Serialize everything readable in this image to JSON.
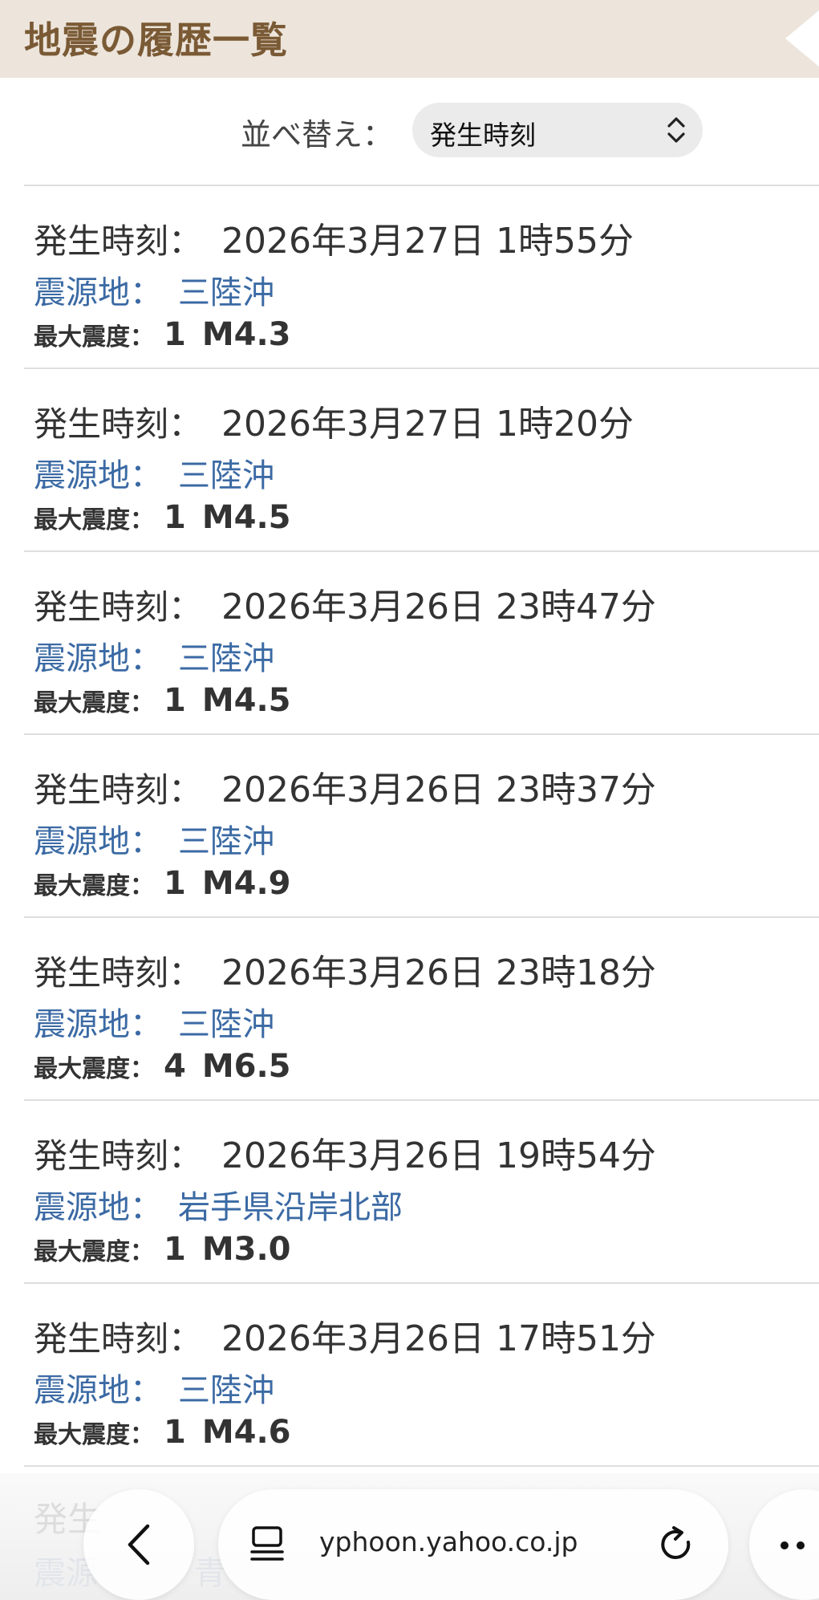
{
  "header": {
    "title": "地震の履歴一覧"
  },
  "sort": {
    "label": "並べ替え：",
    "selected": "発生時刻"
  },
  "labels": {
    "time": "発生時刻：",
    "epicenter": "震源地：",
    "intensity": "最大震度："
  },
  "quakes": [
    {
      "time": "2026年3月27日 1時55分",
      "epicenter": "三陸沖",
      "intensity": "1",
      "magnitude": "M4.3"
    },
    {
      "time": "2026年3月27日 1時20分",
      "epicenter": "三陸沖",
      "intensity": "1",
      "magnitude": "M4.5"
    },
    {
      "time": "2026年3月26日 23時47分",
      "epicenter": "三陸沖",
      "intensity": "1",
      "magnitude": "M4.5"
    },
    {
      "time": "2026年3月26日 23時37分",
      "epicenter": "三陸沖",
      "intensity": "1",
      "magnitude": "M4.9"
    },
    {
      "time": "2026年3月26日 23時18分",
      "epicenter": "三陸沖",
      "intensity": "4",
      "magnitude": "M6.5"
    },
    {
      "time": "2026年3月26日 19時54分",
      "epicenter": "岩手県沿岸北部",
      "intensity": "1",
      "magnitude": "M3.0"
    },
    {
      "time": "2026年3月26日 17時51分",
      "epicenter": "三陸沖",
      "intensity": "1",
      "magnitude": "M4.6"
    }
  ],
  "partial_row": {
    "time_label": "発生",
    "epicenter_label": "震源",
    "epicenter": "青"
  },
  "browser": {
    "url": "yphoon.yahoo.co.jp"
  },
  "colors": {
    "header_bg": "#ede5dc",
    "header_text": "#7a5a35",
    "link_blue": "#3b6aa4"
  },
  "icons": {
    "back": "chevron-left-icon",
    "tabs": "tab-overview-icon",
    "reload": "reload-icon",
    "more": "more-icon"
  }
}
